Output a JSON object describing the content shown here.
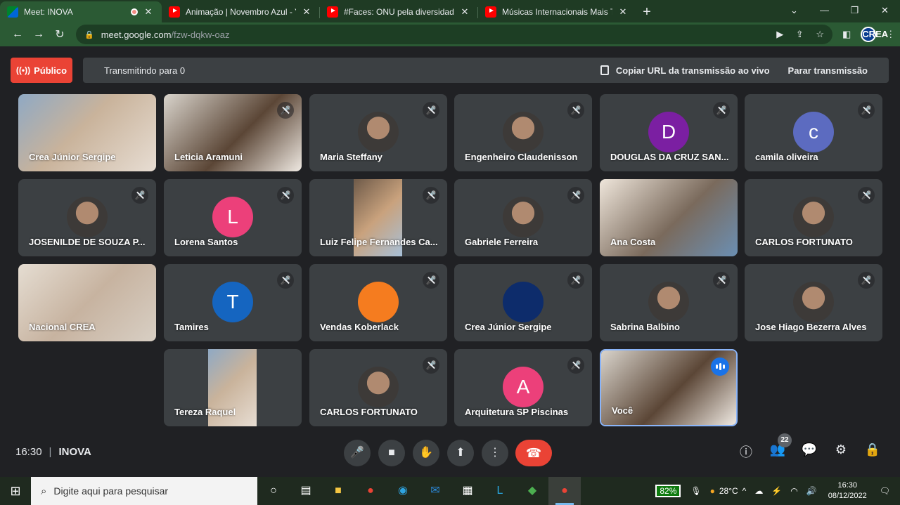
{
  "browser": {
    "tabs": [
      {
        "title": "Meet: INOVA",
        "icon": "meet-icon",
        "active": true
      },
      {
        "title": "Animação | Novembro Azul - You",
        "icon": "youtube-icon"
      },
      {
        "title": "#Faces: ONU pela diversidade LG",
        "icon": "youtube-icon"
      },
      {
        "title": "Músicas Internacionais Mais Toca",
        "icon": "youtube-icon"
      }
    ],
    "url_host": "meet.google.com",
    "url_path": "/fzw-dqkw-oaz"
  },
  "broadcast": {
    "public_label": "Público",
    "status": "Transmitindo para 0",
    "copy_url_label": "Copiar URL da transmissão ao vivo",
    "stop_label": "Parar transmissão"
  },
  "participants": [
    {
      "name": "Crea Júnior Sergipe",
      "kind": "video",
      "muted": false
    },
    {
      "name": "Leticia Aramuni",
      "kind": "video",
      "muted": true
    },
    {
      "name": "Maria Steffany",
      "kind": "photo",
      "muted": true
    },
    {
      "name": "Engenheiro Claudenisson",
      "kind": "photo",
      "muted": true
    },
    {
      "name": "DOUGLAS DA CRUZ SAN...",
      "kind": "letter",
      "letter": "D",
      "color": "#7b1fa2",
      "muted": true
    },
    {
      "name": "camila oliveira",
      "kind": "letter",
      "letter": "c",
      "color": "#5c6bc0",
      "muted": true
    },
    {
      "name": "JOSENILDE DE SOUZA P...",
      "kind": "photo",
      "muted": true
    },
    {
      "name": "Lorena Santos",
      "kind": "letter",
      "letter": "L",
      "color": "#ec407a",
      "muted": true
    },
    {
      "name": "Luiz Felipe Fernandes Ca...",
      "kind": "video",
      "muted": true
    },
    {
      "name": "Gabriele Ferreira",
      "kind": "photo",
      "muted": true
    },
    {
      "name": "Ana Costa",
      "kind": "video",
      "muted": false
    },
    {
      "name": "CARLOS FORTUNATO",
      "kind": "photo",
      "muted": true
    },
    {
      "name": "Nacional CREA",
      "kind": "video",
      "muted": false
    },
    {
      "name": "Tamires",
      "kind": "letter",
      "letter": "T",
      "color": "#1565c0",
      "muted": true
    },
    {
      "name": "Vendas Koberlack",
      "kind": "logo",
      "muted": true
    },
    {
      "name": "Crea Júnior Sergipe",
      "kind": "logo",
      "muted": true
    },
    {
      "name": "Sabrina Balbino",
      "kind": "photo",
      "muted": true
    },
    {
      "name": "Jose Hiago Bezerra Alves",
      "kind": "photo",
      "muted": true
    },
    {
      "name": "Tereza Raquel",
      "kind": "video",
      "muted": false
    },
    {
      "name": "CARLOS FORTUNATO",
      "kind": "photo",
      "muted": true
    },
    {
      "name": "Arquitetura SP Piscinas",
      "kind": "letter",
      "letter": "A",
      "color": "#ec407a",
      "muted": true
    },
    {
      "name": "Você",
      "kind": "video",
      "muted": false,
      "speaking": true
    }
  ],
  "meeting": {
    "time": "16:30",
    "name": "INOVA",
    "participant_count": "22"
  },
  "taskbar": {
    "search_placeholder": "Digite aqui para pesquisar",
    "battery": "82%",
    "temperature": "28°C",
    "time": "16:30",
    "date": "08/12/2022"
  }
}
